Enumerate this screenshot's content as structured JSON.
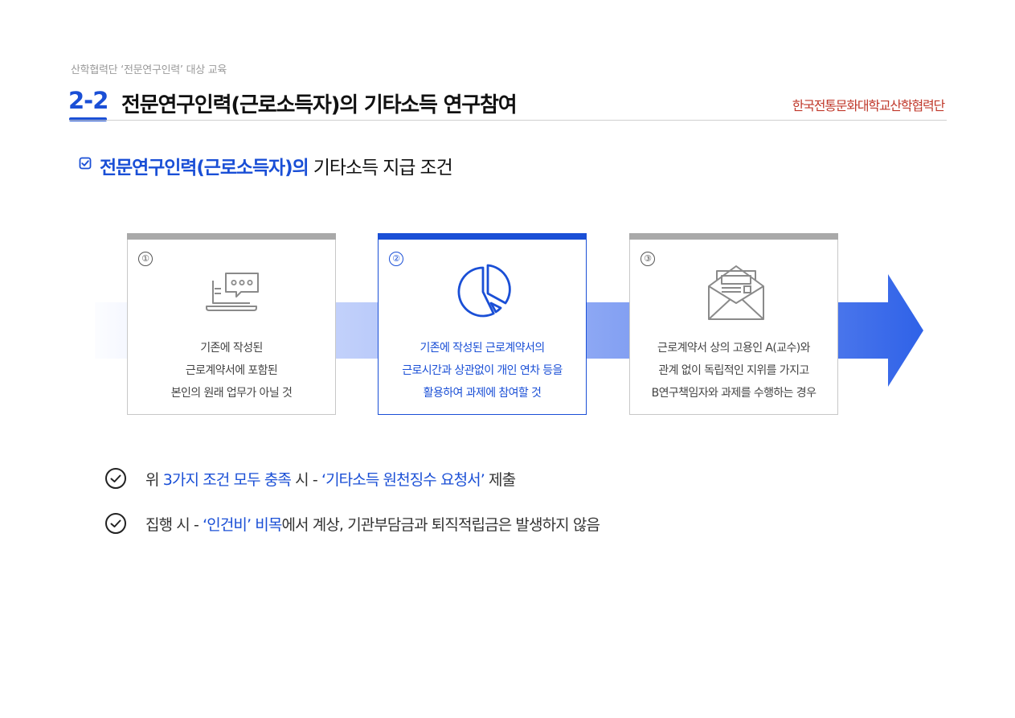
{
  "header": {
    "subtitle": "산학협력단 ‘전문연구인력’ 대상 교육",
    "section_number": "2-2",
    "section_title": "전문연구인력(근로소득자)의 기타소득 연구참여",
    "logo_text": "한국전통문화대학교산학협력단"
  },
  "heading": {
    "highlight": "전문연구인력(근로소득자)의",
    "rest": " 기타소득 지급 조건"
  },
  "cards": [
    {
      "number": "①",
      "icon": "laptop-chat-icon",
      "lines": [
        "기존에 작성된",
        "근로계약서에 포함된",
        "본인의 원래 업무가 아닐 것"
      ]
    },
    {
      "number": "②",
      "icon": "pie-chart-icon",
      "lines": [
        "기존에 작성된 근로계약서의",
        "근로시간과 상관없이 개인 연차 등을",
        "활용하여 과제에 참여할 것"
      ]
    },
    {
      "number": "③",
      "icon": "envelope-document-icon",
      "lines": [
        "근로계약서 상의 고용인 A(교수)와",
        "관계 없이 독립적인 지위를 가지고",
        "B연구책임자와 과제를 수행하는 경우"
      ]
    }
  ],
  "notes": [
    {
      "parts": [
        "위 ",
        "3가지 조건 모두 충족",
        " 시 - ",
        "‘기타소득 원천징수 요청서’",
        " 제출"
      ]
    },
    {
      "parts": [
        "집행 시 - ",
        "‘인건비’ 비목",
        "에서 계상, 기관부담금과 퇴직적립금은 발생하지 않음"
      ]
    }
  ],
  "colors": {
    "accent": "#1a4fd6",
    "inactive_bar": "#a9a9a9",
    "logo": "#c0392b"
  }
}
